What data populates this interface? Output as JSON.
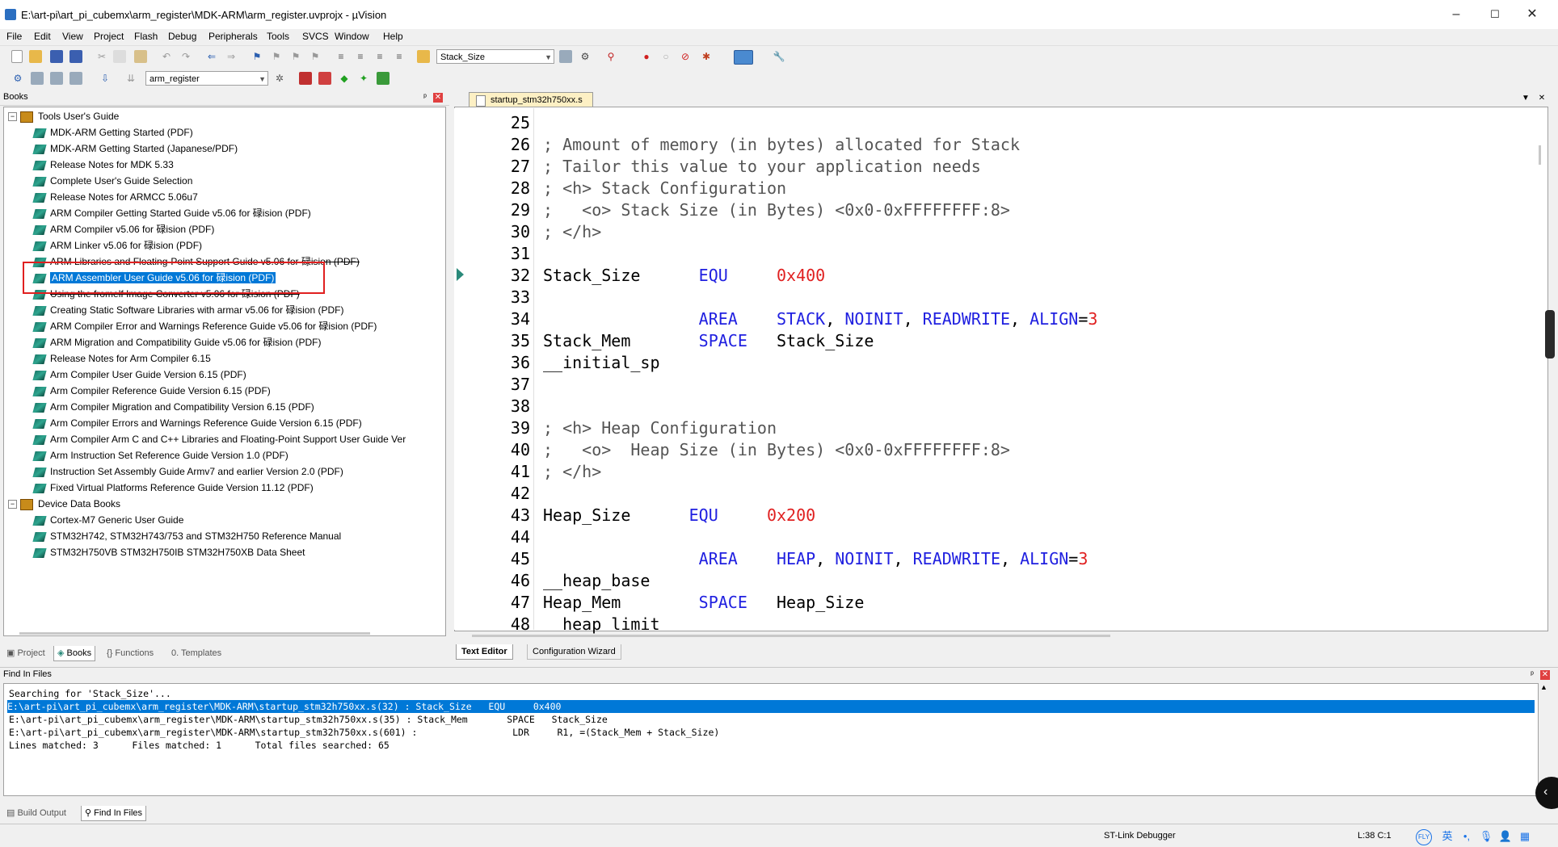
{
  "window": {
    "title": "E:\\art-pi\\art_pi_cubemx\\arm_register\\MDK-ARM\\arm_register.uvprojx - µVision",
    "minimize": "–",
    "maximize": "☐",
    "close": "✕"
  },
  "menu": [
    "File",
    "Edit",
    "View",
    "Project",
    "Flash",
    "Debug",
    "Peripherals",
    "Tools",
    "SVCS",
    "Window",
    "Help"
  ],
  "toolbar": {
    "find_combo": "Stack_Size",
    "target_combo": "arm_register"
  },
  "books_panel": {
    "title": "Books",
    "pin": "ᵖ",
    "close": "✕",
    "groups": [
      {
        "label": "Tools User's Guide",
        "items": [
          "MDK-ARM Getting Started (PDF)",
          "MDK-ARM Getting Started (Japanese/PDF)",
          "Release Notes for MDK 5.33",
          "Complete User's Guide Selection",
          "Release Notes for ARMCC 5.06u7",
          "ARM Compiler Getting Started Guide v5.06 for 碌ision (PDF)",
          "ARM Compiler v5.06 for 碌ision (PDF)",
          "ARM Linker v5.06 for 碌ision (PDF)",
          "ARM Libraries and Floating-Point Support Guide v5.06 for 碌ision (PDF)",
          "ARM Assembler User Guide v5.06 for 碌ision (PDF)",
          "Using the fromelf Image Converter v5.06 for 碌ision (PDF)",
          "Creating Static Software Libraries with armar v5.06 for 碌ision (PDF)",
          "ARM Compiler Error and Warnings Reference Guide v5.06 for 碌ision (PDF)",
          "ARM Migration and Compatibility Guide v5.06 for 碌ision (PDF)",
          "Release Notes for Arm Compiler 6.15",
          "Arm Compiler User Guide Version 6.15 (PDF)",
          "Arm Compiler Reference Guide Version 6.15 (PDF)",
          "Arm Compiler Migration and Compatibility Version 6.15 (PDF)",
          "Arm Compiler Errors and Warnings Reference Guide Version 6.15 (PDF)",
          "Arm Compiler Arm C and C++ Libraries and Floating-Point Support User Guide Ver",
          "Arm Instruction Set Reference Guide Version 1.0 (PDF)",
          "Instruction Set Assembly Guide Armv7 and earlier Version 2.0 (PDF)",
          "Fixed Virtual Platforms Reference Guide Version 11.12 (PDF)"
        ]
      },
      {
        "label": "Device Data Books",
        "items": [
          "Cortex-M7 Generic User Guide",
          "STM32H742, STM32H743/753 and STM32H750 Reference Manual",
          "STM32H750VB STM32H750IB STM32H750XB Data Sheet"
        ]
      }
    ],
    "tabs": [
      "Project",
      "Books",
      "Functions",
      "Templates"
    ]
  },
  "editor": {
    "tab_label": "startup_stm32h750xx.s",
    "bottom_tabs": [
      "Text Editor",
      "Configuration Wizard"
    ],
    "lines": [
      {
        "n": "25",
        "parts": []
      },
      {
        "n": "26",
        "parts": [
          {
            "t": "; Amount of memory (in bytes) allocated for Stack",
            "c": "cm"
          }
        ]
      },
      {
        "n": "27",
        "parts": [
          {
            "t": "; Tailor this value to your application needs",
            "c": "cm"
          }
        ]
      },
      {
        "n": "28",
        "parts": [
          {
            "t": "; <h> Stack Configuration",
            "c": "cm"
          }
        ]
      },
      {
        "n": "29",
        "parts": [
          {
            "t": ";   <o> Stack Size (in Bytes) <0x0-0xFFFFFFFF:8>",
            "c": "cm"
          }
        ]
      },
      {
        "n": "30",
        "parts": [
          {
            "t": "; </h>",
            "c": "cm"
          }
        ]
      },
      {
        "n": "31",
        "parts": []
      },
      {
        "n": "32",
        "parts": [
          {
            "t": "Stack_Size      ",
            "c": ""
          },
          {
            "t": "EQU",
            "c": "kw"
          },
          {
            "t": "     ",
            "c": ""
          },
          {
            "t": "0x400",
            "c": "num"
          }
        ]
      },
      {
        "n": "33",
        "parts": []
      },
      {
        "n": "34",
        "parts": [
          {
            "t": "                ",
            "c": ""
          },
          {
            "t": "AREA",
            "c": "kw"
          },
          {
            "t": "    ",
            "c": ""
          },
          {
            "t": "STACK",
            "c": "kw"
          },
          {
            "t": ", ",
            "c": ""
          },
          {
            "t": "NOINIT",
            "c": "kw"
          },
          {
            "t": ", ",
            "c": ""
          },
          {
            "t": "READWRITE",
            "c": "kw"
          },
          {
            "t": ", ",
            "c": ""
          },
          {
            "t": "ALIGN",
            "c": "kw"
          },
          {
            "t": "=",
            "c": ""
          },
          {
            "t": "3",
            "c": "num"
          }
        ]
      },
      {
        "n": "35",
        "parts": [
          {
            "t": "Stack_Mem       ",
            "c": ""
          },
          {
            "t": "SPACE",
            "c": "kw"
          },
          {
            "t": "   Stack_Size",
            "c": ""
          }
        ]
      },
      {
        "n": "36",
        "parts": [
          {
            "t": "__initial_sp",
            "c": ""
          }
        ]
      },
      {
        "n": "37",
        "parts": []
      },
      {
        "n": "38",
        "parts": []
      },
      {
        "n": "39",
        "parts": [
          {
            "t": "; <h> Heap Configuration",
            "c": "cm"
          }
        ]
      },
      {
        "n": "40",
        "parts": [
          {
            "t": ";   <o>  Heap Size (in Bytes) <0x0-0xFFFFFFFF:8>",
            "c": "cm"
          }
        ]
      },
      {
        "n": "41",
        "parts": [
          {
            "t": "; </h>",
            "c": "cm"
          }
        ]
      },
      {
        "n": "42",
        "parts": []
      },
      {
        "n": "43",
        "parts": [
          {
            "t": "Heap_Size      ",
            "c": ""
          },
          {
            "t": "EQU",
            "c": "kw"
          },
          {
            "t": "     ",
            "c": ""
          },
          {
            "t": "0x200",
            "c": "num"
          }
        ]
      },
      {
        "n": "44",
        "parts": []
      },
      {
        "n": "45",
        "parts": [
          {
            "t": "                ",
            "c": ""
          },
          {
            "t": "AREA",
            "c": "kw"
          },
          {
            "t": "    ",
            "c": ""
          },
          {
            "t": "HEAP",
            "c": "kw"
          },
          {
            "t": ", ",
            "c": ""
          },
          {
            "t": "NOINIT",
            "c": "kw"
          },
          {
            "t": ", ",
            "c": ""
          },
          {
            "t": "READWRITE",
            "c": "kw"
          },
          {
            "t": ", ",
            "c": ""
          },
          {
            "t": "ALIGN",
            "c": "kw"
          },
          {
            "t": "=",
            "c": ""
          },
          {
            "t": "3",
            "c": "num"
          }
        ]
      },
      {
        "n": "46",
        "parts": [
          {
            "t": "__heap_base",
            "c": ""
          }
        ]
      },
      {
        "n": "47",
        "parts": [
          {
            "t": "Heap_Mem        ",
            "c": ""
          },
          {
            "t": "SPACE",
            "c": "kw"
          },
          {
            "t": "   Heap_Size",
            "c": ""
          }
        ]
      },
      {
        "n": "48",
        "parts": [
          {
            "t": "  heap limit",
            "c": ""
          }
        ]
      }
    ]
  },
  "find_in_files": {
    "title": "Find In Files",
    "lines": [
      "Searching for 'Stack_Size'...",
      "E:\\art-pi\\art_pi_cubemx\\arm_register\\MDK-ARM\\startup_stm32h750xx.s(32) : Stack_Size   EQU     0x400",
      "E:\\art-pi\\art_pi_cubemx\\arm_register\\MDK-ARM\\startup_stm32h750xx.s(35) : Stack_Mem       SPACE   Stack_Size",
      "E:\\art-pi\\art_pi_cubemx\\arm_register\\MDK-ARM\\startup_stm32h750xx.s(601) :                 LDR     R1, =(Stack_Mem + Stack_Size)",
      "Lines matched: 3      Files matched: 1      Total files searched: 65"
    ],
    "output_tabs": [
      "Build Output",
      "Find In Files"
    ]
  },
  "status": {
    "debugger": "ST-Link Debugger",
    "position": "L:38 C:1"
  },
  "colors": {
    "selection": "#0078d7",
    "keyword": "#2020e0",
    "number": "#e02020",
    "highlight_box": "#e02020"
  }
}
